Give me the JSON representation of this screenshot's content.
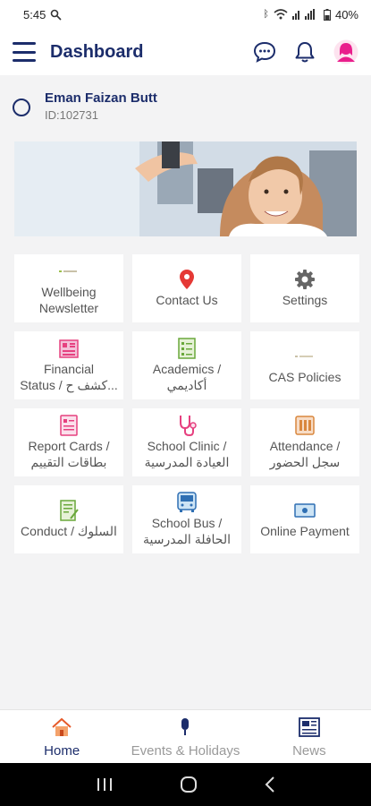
{
  "status": {
    "time": "5:45",
    "battery": "40%"
  },
  "appbar": {
    "title": "Dashboard"
  },
  "profile": {
    "name": "Eman Faizan Butt",
    "id": "ID:102731"
  },
  "tiles": [
    {
      "label": "Wellbeing",
      "label2": "Newsletter",
      "icon": "newsletter-icon"
    },
    {
      "label": "Contact Us",
      "label2": "",
      "icon": "location-pin-icon"
    },
    {
      "label": "Settings",
      "label2": "",
      "icon": "gear-icon"
    },
    {
      "label": "Financial",
      "label2": "Status / كشف ح...",
      "icon": "finance-icon"
    },
    {
      "label": "Academics /",
      "label2": "أكاديمي",
      "icon": "academics-icon"
    },
    {
      "label": "CAS Policies",
      "label2": "",
      "icon": "policy-icon"
    },
    {
      "label": "Report Cards /",
      "label2": "بطاقات التقييم",
      "icon": "report-card-icon"
    },
    {
      "label": "School Clinic /",
      "label2": "العيادة المدرسية",
      "icon": "stethoscope-icon"
    },
    {
      "label": "Attendance /",
      "label2": "سجل الحضور",
      "icon": "attendance-icon"
    },
    {
      "label": "Conduct / السلوك",
      "label2": "",
      "icon": "conduct-icon"
    },
    {
      "label": "School Bus /",
      "label2": "الحافلة المدرسية",
      "icon": "bus-icon"
    },
    {
      "label": "Online Payment",
      "label2": "",
      "icon": "payment-icon"
    }
  ],
  "bottomnav": {
    "home": "Home",
    "events": "Events & Holidays",
    "news": "News"
  },
  "colors": {
    "primary": "#1c2d6b",
    "accent": "#e91e8c",
    "pin": "#e53935"
  }
}
